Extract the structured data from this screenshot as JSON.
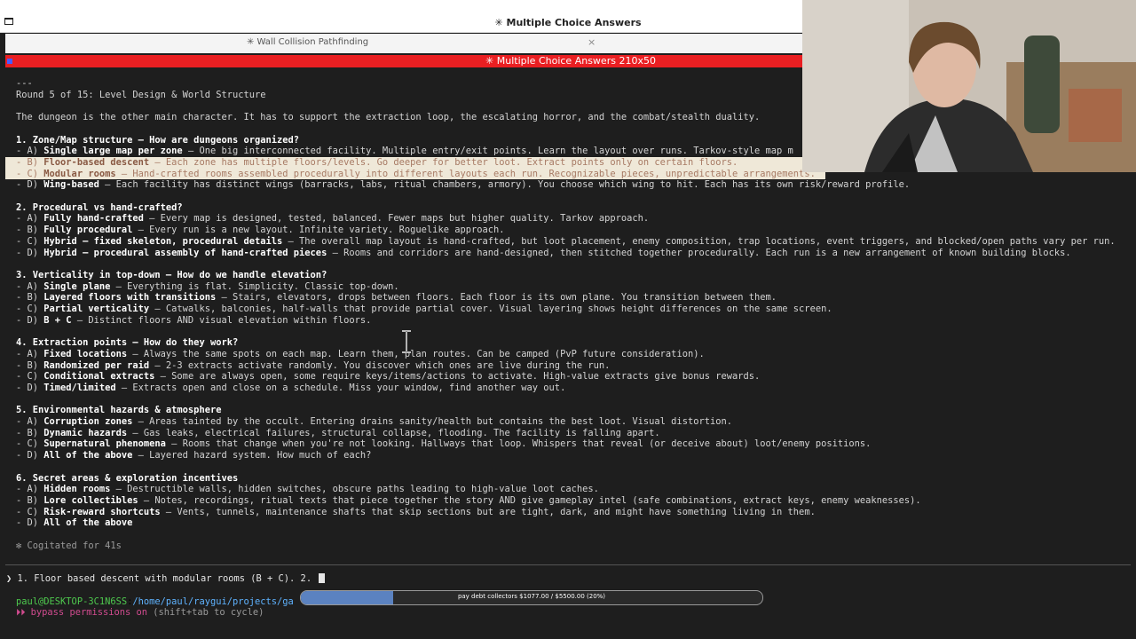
{
  "window": {
    "title": "✳ Multiple Choice Answers"
  },
  "tab": {
    "title": "✳ Wall Collision Pathfinding",
    "close_glyph": "×"
  },
  "pane": {
    "title": "✳ Multiple Choice Answers 210x50"
  },
  "terminal": {
    "separator": "---",
    "round_title": "Round 5 of 15: Level Design & World Structure",
    "intro": "The dungeon is the other main character. It has to support the extraction loop, the escalating horror, and the combat/stealth duality.",
    "questions": [
      {
        "heading": "1. Zone/Map structure — How are dungeons organized?",
        "options": [
          {
            "prefix": "- A) ",
            "bold": "Single large map per zone",
            "rest": " — One big interconnected facility. Multiple entry/exit points. Learn the layout over runs. Tarkov-style map m"
          },
          {
            "prefix": "- B) ",
            "bold": "Floor-based descent",
            "rest": " — Each zone has multiple floors/levels. Go deeper for better loot. Extract points only on certain floors."
          },
          {
            "prefix": "- C) ",
            "bold": "Modular rooms",
            "rest": " — Hand-crafted rooms assembled procedurally into different layouts each run. Recognizable pieces, unpredictable arrangements."
          },
          {
            "prefix": "- D) ",
            "bold": "Wing-based",
            "rest": " — Each facility has distinct wings (barracks, labs, ritual chambers, armory). You choose which wing to hit. Each has its own risk/reward profile."
          }
        ]
      },
      {
        "heading": "2. Procedural vs hand-crafted?",
        "options": [
          {
            "prefix": "- A) ",
            "bold": "Fully hand-crafted",
            "rest": " — Every map is designed, tested, balanced. Fewer maps but higher quality. Tarkov approach."
          },
          {
            "prefix": "- B) ",
            "bold": "Fully procedural",
            "rest": " — Every run is a new layout. Infinite variety. Roguelike approach."
          },
          {
            "prefix": "- C) ",
            "bold": "Hybrid — fixed skeleton, procedural details",
            "rest": " — The overall map layout is hand-crafted, but loot placement, enemy composition, trap locations, event triggers, and blocked/open paths vary per run."
          },
          {
            "prefix": "- D) ",
            "bold": "Hybrid — procedural assembly of hand-crafted pieces",
            "rest": " — Rooms and corridors are hand-designed, then stitched together procedurally. Each run is a new arrangement of known building blocks."
          }
        ]
      },
      {
        "heading": "3. Verticality in top-down — How do we handle elevation?",
        "options": [
          {
            "prefix": "- A) ",
            "bold": "Single plane",
            "rest": " — Everything is flat. Simplicity. Classic top-down."
          },
          {
            "prefix": "- B) ",
            "bold": "Layered floors with transitions",
            "rest": " — Stairs, elevators, drops between floors. Each floor is its own plane. You transition between them."
          },
          {
            "prefix": "- C) ",
            "bold": "Partial verticality",
            "rest": " — Catwalks, balconies, half-walls that provide partial cover. Visual layering shows height differences on the same screen."
          },
          {
            "prefix": "- D) ",
            "bold": "B + C",
            "rest": " — Distinct floors AND visual elevation within floors."
          }
        ]
      },
      {
        "heading": "4. Extraction points — How do they work?",
        "options": [
          {
            "prefix": "- A) ",
            "bold": "Fixed locations",
            "rest": " — Always the same spots on each map. Learn them, plan routes. Can be camped (PvP future consideration)."
          },
          {
            "prefix": "- B) ",
            "bold": "Randomized per raid",
            "rest": " — 2-3 extracts activate randomly. You discover which ones are live during the run."
          },
          {
            "prefix": "- C) ",
            "bold": "Conditional extracts",
            "rest": " — Some are always open, some require keys/items/actions to activate. High-value extracts give bonus rewards."
          },
          {
            "prefix": "- D) ",
            "bold": "Timed/limited",
            "rest": " — Extracts open and close on a schedule. Miss your window, find another way out."
          }
        ]
      },
      {
        "heading": "5. Environmental hazards & atmosphere",
        "options": [
          {
            "prefix": "- A) ",
            "bold": "Corruption zones",
            "rest": " — Areas tainted by the occult. Entering drains sanity/health but contains the best loot. Visual distortion."
          },
          {
            "prefix": "- B) ",
            "bold": "Dynamic hazards",
            "rest": " — Gas leaks, electrical failures, structural collapse, flooding. The facility is falling apart."
          },
          {
            "prefix": "- C) ",
            "bold": "Supernatural phenomena",
            "rest": " — Rooms that change when you're not looking. Hallways that loop. Whispers that reveal (or deceive about) loot/enemy positions."
          },
          {
            "prefix": "- D) ",
            "bold": "All of the above",
            "rest": " — Layered hazard system. How much of each?"
          }
        ]
      },
      {
        "heading": "6. Secret areas & exploration incentives",
        "options": [
          {
            "prefix": "- A) ",
            "bold": "Hidden rooms",
            "rest": " — Destructible walls, hidden switches, obscure paths leading to high-value loot caches."
          },
          {
            "prefix": "- B) ",
            "bold": "Lore collectibles",
            "rest": " — Notes, recordings, ritual texts that piece together the story AND give gameplay intel (safe combinations, extract keys, enemy weaknesses)."
          },
          {
            "prefix": "- C) ",
            "bold": "Risk-reward shortcuts",
            "rest": " — Vents, tunnels, maintenance shafts that skip sections but are tight, dark, and might have something living in them."
          },
          {
            "prefix": "- D) ",
            "bold": "All of the above",
            "rest": ""
          }
        ]
      }
    ],
    "cogitated": "✻ Cogitated for 41s",
    "prompt_glyph": "❯",
    "prompt_input": " 1. Floor based descent with modular rooms (B + C). 2. ",
    "status_user": "paul@DESKTOP-3C1N6SS",
    "status_sep": ":",
    "status_path": "/home/paul/raygui/projects/ga",
    "perm_glyph": "⏵⏵",
    "perm_text": "bypass permissions on",
    "perm_hint": " (shift+tab to cycle)"
  },
  "progress": {
    "label": "pay debt collectors $1077.00 / $5500.00 (20%)",
    "fraction": 0.2,
    "color": "#5b82c0"
  }
}
